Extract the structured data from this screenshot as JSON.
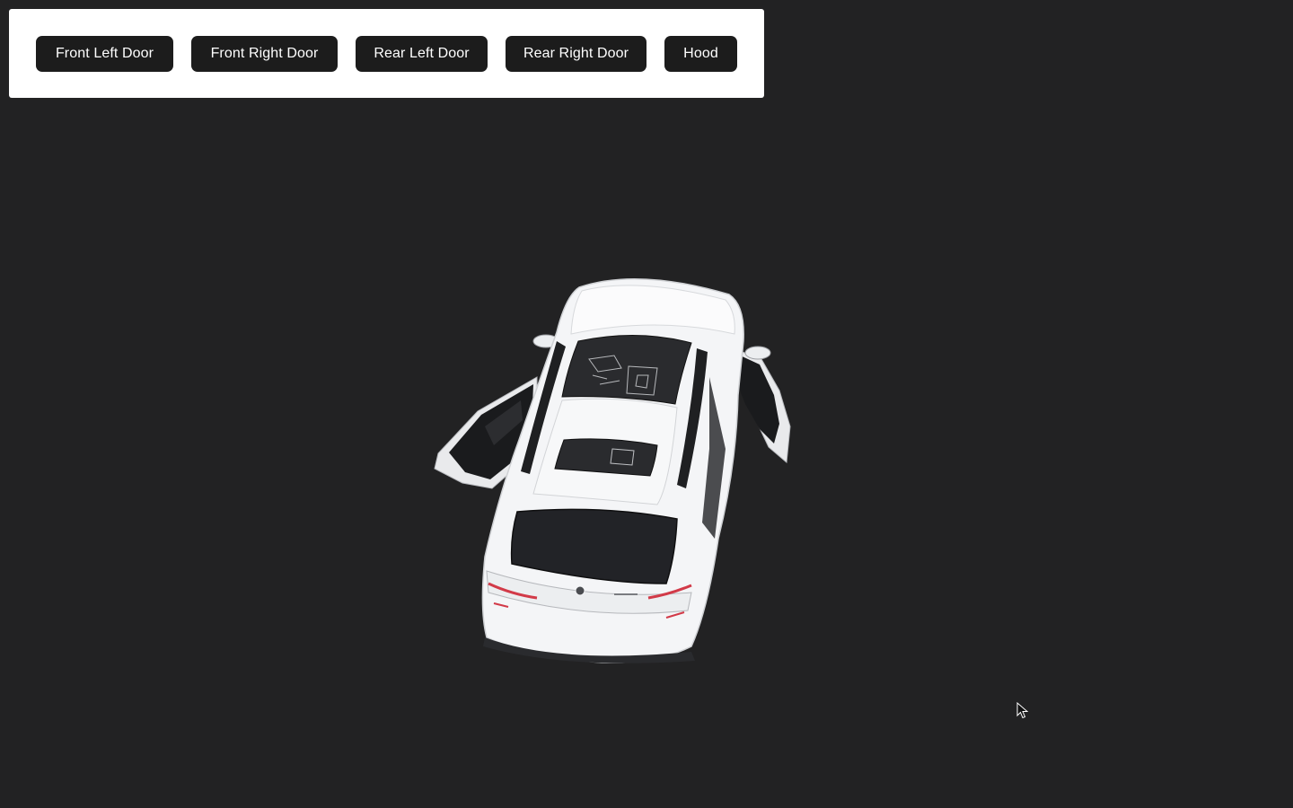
{
  "toolbar": {
    "buttons": [
      {
        "label": "Front Left Door"
      },
      {
        "label": "Front Right Door"
      },
      {
        "label": "Rear Left Door"
      },
      {
        "label": "Rear Right Door"
      },
      {
        "label": "Hood"
      }
    ]
  },
  "scene": {
    "model": "car-3d-model",
    "background_color": "#222223",
    "car_color": "#f4f5f7"
  },
  "cursor": {
    "icon": "arrow-cursor-icon"
  }
}
